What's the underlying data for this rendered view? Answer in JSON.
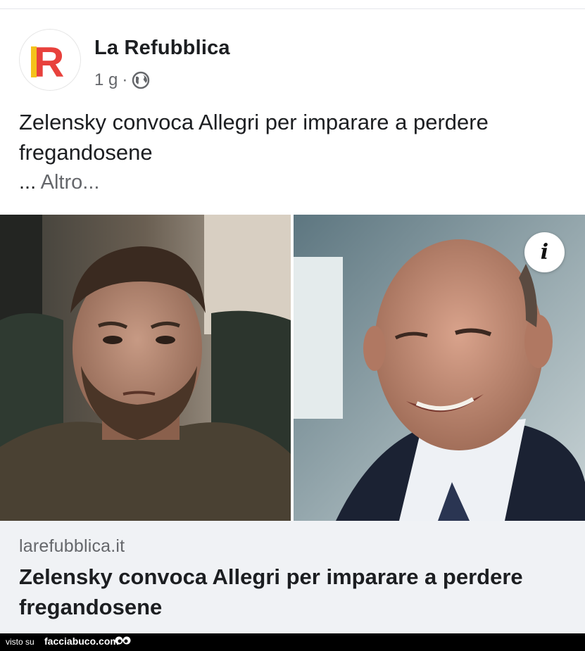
{
  "post": {
    "page_name": "La Refubblica",
    "logo_letter": "R",
    "time": "1 g",
    "separator": "·",
    "audience_icon": "globe-icon",
    "text": "Zelensky convoca Allegri per imparare a perdere fregandosene",
    "more_dots": "...",
    "more_label": "Altro..."
  },
  "photos": {
    "left": "Zelensky portrait",
    "right": "Allegri portrait",
    "info_label": "i"
  },
  "link": {
    "domain": "larefubblica.it",
    "title": "Zelensky convoca Allegri per imparare a perdere fregandosene"
  },
  "watermark": {
    "prefix": "visto su",
    "site": "facciabuco.com"
  },
  "colors": {
    "logo_red": "#e8413c",
    "logo_yellow": "#f4c21b",
    "secondary_text": "#65676b",
    "link_bg": "#f0f2f5"
  }
}
